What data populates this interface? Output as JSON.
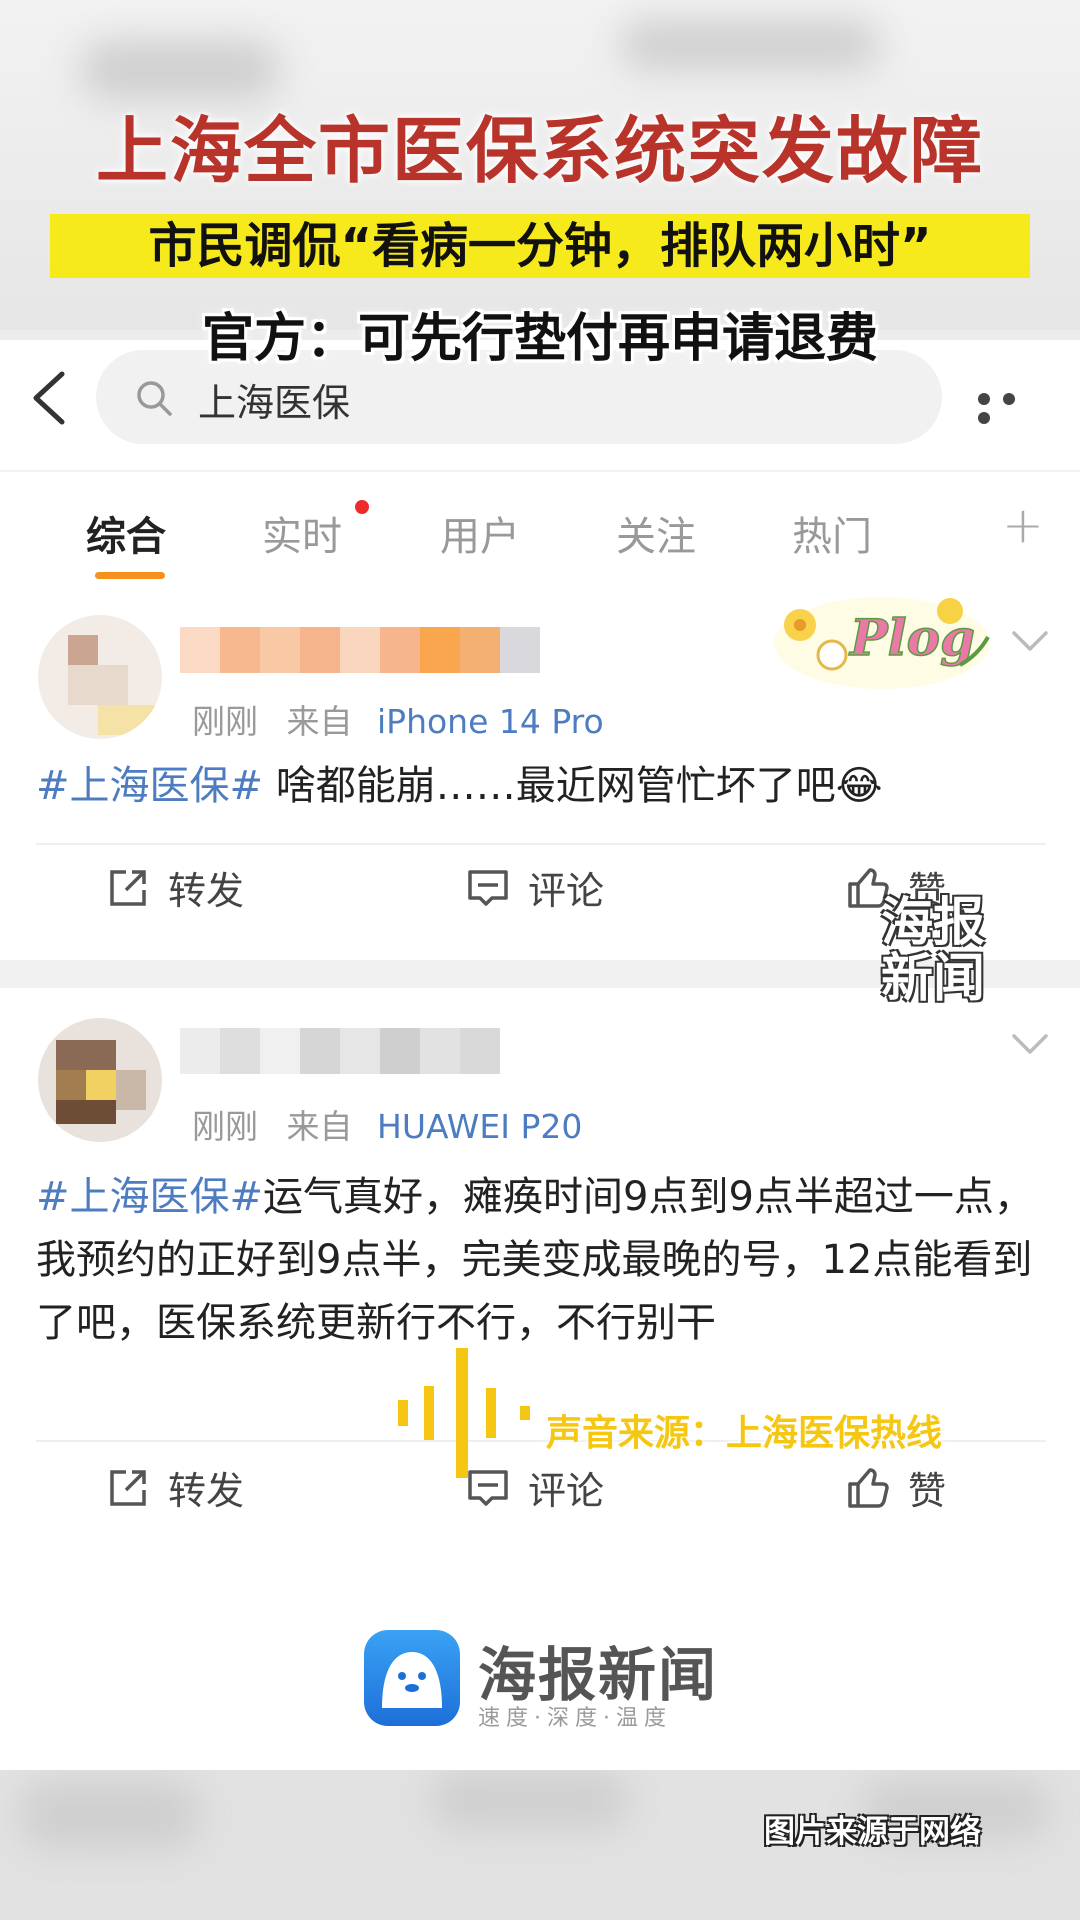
{
  "overlay": {
    "headline": "上海全市医保系统突发故障",
    "subheadline": "市民调侃“看病一分钟，排队两小时”",
    "official_note": "官方：可先行垫付再申请退费",
    "source_note": "图片来源于网络",
    "audio_source": "声音来源：上海医保热线",
    "watermark": "海报\n新闻"
  },
  "search": {
    "query": "上海医保"
  },
  "tabs": [
    {
      "label": "综合",
      "active": true
    },
    {
      "label": "实时",
      "active": false,
      "has_dot": true
    },
    {
      "label": "用户",
      "active": false
    },
    {
      "label": "关注",
      "active": false
    },
    {
      "label": "热门",
      "active": false
    }
  ],
  "tab_plus": "+",
  "posts": [
    {
      "time": "刚刚",
      "source_prefix": "来自",
      "device": "iPhone 14 Pro",
      "hashtag": "#上海医保#",
      "text": " 啥都能崩……最近网管忙坏了吧😂",
      "actions": {
        "repost": "转发",
        "comment": "评论",
        "like": "赞"
      }
    },
    {
      "time": "刚刚",
      "source_prefix": "来自",
      "device": "HUAWEI P20",
      "hashtag": "#上海医保#",
      "text": "运气真好，瘫痪时间9点到9点半超过一点，我预约的正好到9点半，完美变成最晚的号，12点能看到了吧，医保系统更新行不行，不行别干",
      "actions": {
        "repost": "转发",
        "comment": "评论",
        "like": "赞"
      }
    }
  ],
  "footer": {
    "brand": "海报新闻",
    "slogan": "速度·深度·温度"
  },
  "colors": {
    "headline": "#b8332a",
    "highlight": "#f6ea1c",
    "accent_tab": "#f6911e",
    "link_blue": "#4d7cc0"
  }
}
